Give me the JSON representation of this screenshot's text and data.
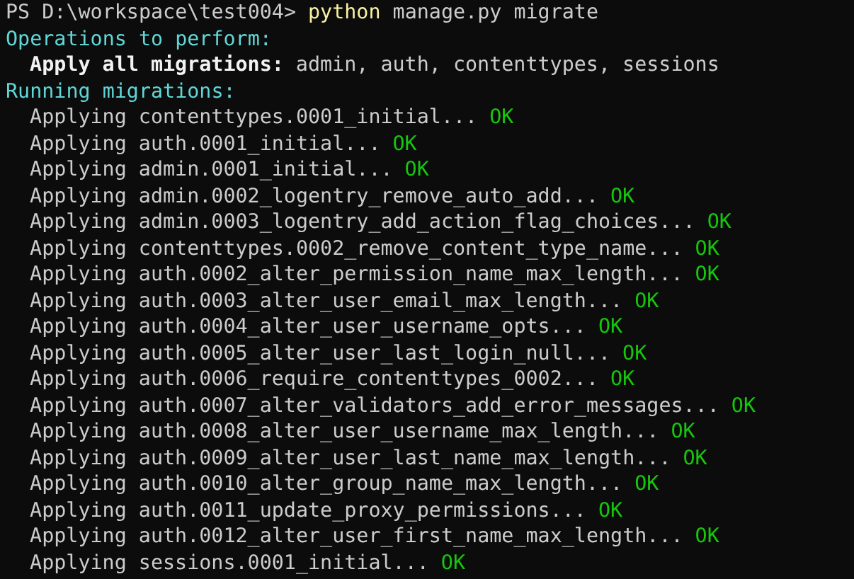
{
  "prompt": {
    "location": "PS D:\\workspace\\test004>",
    "program": "python",
    "arguments": "manage.py migrate"
  },
  "lines": [
    {
      "kind": "heading",
      "text": "Operations to perform:"
    },
    {
      "kind": "detail",
      "label": "Apply all migrations:",
      "text": "admin, auth, contenttypes, sessions"
    },
    {
      "kind": "heading",
      "text": "Running migrations:"
    },
    {
      "kind": "migration",
      "text": "Applying contenttypes.0001_initial...",
      "status": "OK"
    },
    {
      "kind": "migration",
      "text": "Applying auth.0001_initial...",
      "status": "OK"
    },
    {
      "kind": "migration",
      "text": "Applying admin.0001_initial...",
      "status": "OK"
    },
    {
      "kind": "migration",
      "text": "Applying admin.0002_logentry_remove_auto_add...",
      "status": "OK"
    },
    {
      "kind": "migration",
      "text": "Applying admin.0003_logentry_add_action_flag_choices...",
      "status": "OK"
    },
    {
      "kind": "migration",
      "text": "Applying contenttypes.0002_remove_content_type_name...",
      "status": "OK"
    },
    {
      "kind": "migration",
      "text": "Applying auth.0002_alter_permission_name_max_length...",
      "status": "OK"
    },
    {
      "kind": "migration",
      "text": "Applying auth.0003_alter_user_email_max_length...",
      "status": "OK"
    },
    {
      "kind": "migration",
      "text": "Applying auth.0004_alter_user_username_opts...",
      "status": "OK"
    },
    {
      "kind": "migration",
      "text": "Applying auth.0005_alter_user_last_login_null...",
      "status": "OK"
    },
    {
      "kind": "migration",
      "text": "Applying auth.0006_require_contenttypes_0002...",
      "status": "OK"
    },
    {
      "kind": "migration",
      "text": "Applying auth.0007_alter_validators_add_error_messages...",
      "status": "OK"
    },
    {
      "kind": "migration",
      "text": "Applying auth.0008_alter_user_username_max_length...",
      "status": "OK"
    },
    {
      "kind": "migration",
      "text": "Applying auth.0009_alter_user_last_name_max_length...",
      "status": "OK"
    },
    {
      "kind": "migration",
      "text": "Applying auth.0010_alter_group_name_max_length...",
      "status": "OK"
    },
    {
      "kind": "migration",
      "text": "Applying auth.0011_update_proxy_permissions...",
      "status": "OK"
    },
    {
      "kind": "migration",
      "text": "Applying auth.0012_alter_user_first_name_max_length...",
      "status": "OK"
    },
    {
      "kind": "migration",
      "text": "Applying sessions.0001_initial...",
      "status": "OK"
    }
  ]
}
